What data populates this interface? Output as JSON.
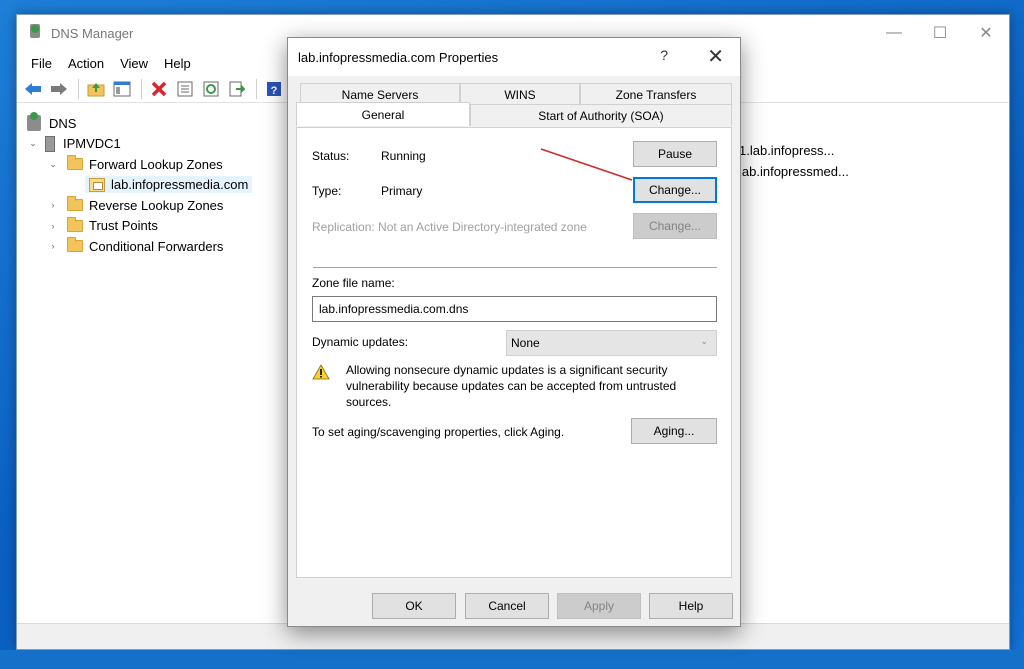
{
  "main_window": {
    "title": "DNS Manager",
    "controls": {
      "minimize": "—",
      "maximize": "☐",
      "close": "✕"
    }
  },
  "menu": [
    "File",
    "Action",
    "View",
    "Help"
  ],
  "toolbar_icons": [
    "back-arrow-icon",
    "forward-arrow-icon",
    "up-folder-icon",
    "show-hide-tree-icon",
    "delete-icon",
    "properties-icon",
    "refresh-icon",
    "export-list-icon",
    "help-icon"
  ],
  "tree": {
    "root": "DNS",
    "server": "IPMVDC1",
    "forward_zones": "Forward Lookup Zones",
    "zone": "lab.infopressmedia.com",
    "reverse_zones": "Reverse Lookup Zones",
    "trust_points": "Trust Points",
    "conditional_forwarders": "Conditional Forwarders"
  },
  "right_pane": {
    "row1": "1.lab.infopress...",
    "row2": "lab.infopressmed..."
  },
  "dialog": {
    "title": "lab.infopressmedia.com Properties",
    "help_glyph": "?",
    "close_glyph": "✕",
    "tabs_row1": [
      "Name Servers",
      "WINS",
      "Zone Transfers"
    ],
    "tabs_row2": [
      "General",
      "Start of Authority (SOA)"
    ],
    "active_tab": "General",
    "status_label": "Status:",
    "status_value": "Running",
    "pause_button": "Pause",
    "type_label": "Type:",
    "type_value": "Primary",
    "type_change_button": "Change...",
    "replication_text": "Replication:  Not an Active Directory-integrated zone",
    "replication_change_button": "Change...",
    "zone_file_label": "Zone file name:",
    "zone_file_value": "lab.infopressmedia.com.dns",
    "dynamic_updates_label": "Dynamic updates:",
    "dynamic_updates_value": "None",
    "warning_text": "Allowing nonsecure dynamic updates is a significant security vulnerability because updates can be accepted from untrusted sources.",
    "aging_text": "To set aging/scavenging properties, click Aging.",
    "aging_button": "Aging...",
    "ok_button": "OK",
    "cancel_button": "Cancel",
    "apply_button": "Apply",
    "help_button": "Help"
  },
  "colors": {
    "desktop": "#0a5fc0",
    "annotation_arrow": "#d12a2a",
    "focus_border": "#0078d7",
    "warning_yellow": "#f7d038"
  }
}
